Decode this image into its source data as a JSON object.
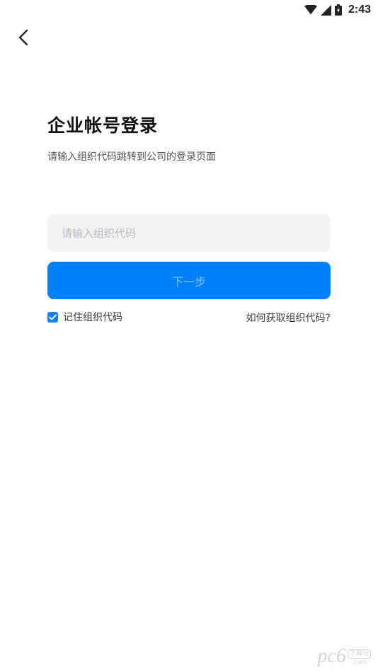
{
  "status_bar": {
    "time": "2:43",
    "icons": [
      "wifi-icon",
      "signal-icon",
      "battery-icon"
    ]
  },
  "header": {
    "back_icon": "chevron-left-icon"
  },
  "login": {
    "title": "企业帐号登录",
    "subtitle": "请输入组织代码跳转到公司的登录页面",
    "org_code_input": {
      "value": "",
      "placeholder": "请输入组织代码"
    },
    "next_button_label": "下一步",
    "remember": {
      "label": "记住组织代码",
      "checked": true
    },
    "help_link": "如何获取组织代码?"
  },
  "watermark": {
    "main": "pc6",
    "top": "下载站",
    "sub": ".com"
  },
  "colors": {
    "accent": "#0080f8",
    "button_text_disabled": "#7fbffb",
    "input_background": "#f2f2f4",
    "checkbox": "#1a7ef5"
  }
}
